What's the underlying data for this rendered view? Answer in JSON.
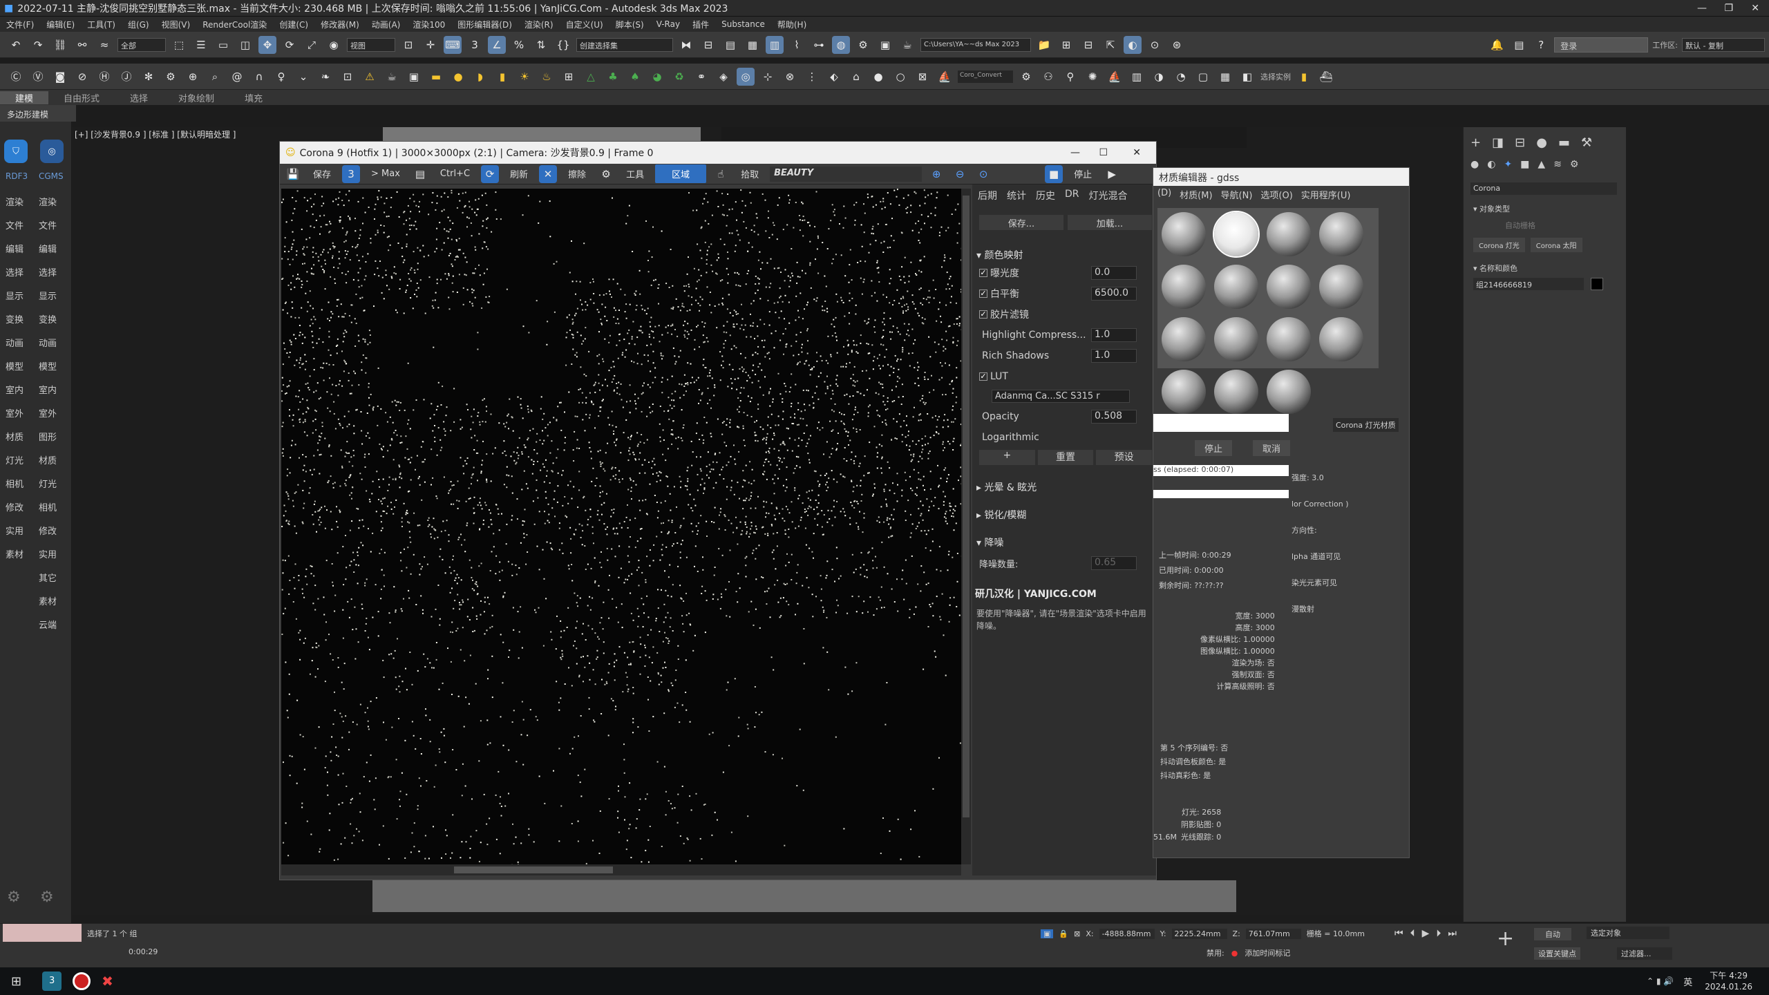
{
  "titlebar": {
    "text": "2022-07-11  主静-沈俊同挑空别墅静态三张.max  - 当前文件大小: 230.468 MB  | 上次保存时间: 嗡嗡久之前 11:55:06  | YanJiCG.Com  - Autodesk 3ds Max 2023"
  },
  "menu": [
    "文件(F)",
    "编辑(E)",
    "工具(T)",
    "组(G)",
    "视图(V)",
    "RenderCool渲染",
    "创建(C)",
    "修改器(M)",
    "动画(A)",
    "渲染100",
    "图形编辑器(D)",
    "渲染(R)",
    "自定义(U)",
    "脚本(S)",
    "V-Ray",
    "插件",
    "Substance",
    "帮助(H)"
  ],
  "toolbar": {
    "selection_filter": "全部",
    "view_dropdown": "视图",
    "named_selection": "创建选择集",
    "path": "C:\\Users\\YA~~ds Max 2023",
    "login": "登录",
    "workspace_label": "工作区:",
    "workspace": "默认 - 复制",
    "corona_convert": "Coro_Convert",
    "ref_label": "选择实例"
  },
  "ribbon": {
    "tabs": [
      "建模",
      "自由形式",
      "选择",
      "对象绘制",
      "填充"
    ],
    "active": "建模",
    "sub": "多边形建模"
  },
  "left_dock": {
    "top_labels": [
      "RDF3",
      "CGMS"
    ],
    "col1": [
      "渲染",
      "文件",
      "编辑",
      "选择",
      "显示",
      "变换",
      "动画",
      "模型",
      "室内",
      "室外",
      "材质",
      "灯光",
      "相机",
      "修改",
      "实用",
      "素材"
    ],
    "col2": [
      "渲染",
      "文件",
      "编辑",
      "选择",
      "显示",
      "变换",
      "动画",
      "模型",
      "室内",
      "室外",
      "图形",
      "材质",
      "灯光",
      "相机",
      "修改",
      "实用",
      "其它",
      "素材",
      "云端"
    ]
  },
  "viewport": {
    "label": "[+] [沙发背景0.9 ] [标准 ] [默认明暗处理 ]"
  },
  "vfb": {
    "title": "Corona 9 (Hotfix 1) | 3000×3000px (2:1) | Camera: 沙发背景0.9 | Frame 0",
    "toolbar": [
      "保存",
      "> Max",
      "Ctrl+C",
      "刷新",
      "擦除",
      "工具",
      "区域",
      "拾取"
    ],
    "channel": "BEAUTY",
    "stop": "停止",
    "panel_tabs": [
      "后期",
      "统计",
      "历史",
      "DR",
      "灯光混合"
    ],
    "save_btn": "保存...",
    "load_btn": "加载...",
    "tone_mapping": "颜色映射",
    "exposure_label": "曝光度",
    "exposure": "0.0",
    "wb_label": "白平衡",
    "wb": "6500.0",
    "film_label": "胶片滤镜",
    "hc_label": "Highlight Compress...",
    "hc": "1.0",
    "rs_label": "Rich Shadows",
    "rs": "1.0",
    "lut_label": "LUT",
    "lut_file": "Adanmq Ca...SC S315 r",
    "opacity_label": "Opacity",
    "opacity": "0.508",
    "log_label": "Logarithmic",
    "plus": "+",
    "reset": "重置",
    "preset": "预设",
    "bloom": "光晕 & 眩光",
    "sharpen": "锐化/模糊",
    "denoise": "降噪",
    "denoise_amt_label": "降噪数量:",
    "denoise_amt": "0.65",
    "credit": "研几汉化 | YANJICG.COM",
    "note": "要使用\"降噪器\", 请在\"场景渲染\"选项卡中启用降噪。"
  },
  "material_editor": {
    "title": "材质编辑器 - gdss",
    "menu": [
      "(D)",
      "材质(M)",
      "导航(N)",
      "选项(O)",
      "实用程序(U)"
    ],
    "stop": "停止",
    "cancel": "取消",
    "elapsed": "ss (elapsed: 0:00:07)",
    "stats": [
      "上一帧时间:  0:00:29",
      "已用时间:  0:00:00",
      "剩余时间:  ??:??:??"
    ],
    "info": [
      "宽度: 3000",
      "高度: 3000",
      "像素纵横比: 1.00000",
      "图像纵横比: 1.00000",
      "渲染为场: 否",
      "强制双面: 否",
      "计算高级照明: 否"
    ],
    "info2": [
      "第 5 个序列编号: 否",
      "抖动调色板颜色: 是",
      "抖动真彩色: 是"
    ],
    "info3": [
      "灯光: 2658",
      "阴影贴图: 0",
      "光线跟踪: 0"
    ],
    "mem": "51.6M",
    "right_labels": [
      "强度: 3.0",
      "lor Correction )",
      "方向性:",
      "lpha 通道可见",
      "染光元素可见",
      "漫散射"
    ],
    "corona_light_mtl": "Corona 灯光材质"
  },
  "command_panel": {
    "renderer": "Corona",
    "object_type": "对象类型",
    "auto_grid": "自动栅格",
    "btn1": "Corona 灯光",
    "btn2": "Corona 太阳",
    "name_color": "名称和颜色",
    "name": "组2146666819"
  },
  "statusbar": {
    "selected": "选择了 1 个 组",
    "time": "0:00:29",
    "x": "-4888.88mm",
    "y": "2225.24mm",
    "z": "761.07mm",
    "grid": "栅格 = 10.0mm",
    "disabled": "禁用:",
    "add_tag": "添加时间标记",
    "auto": "自动",
    "selected_obj": "选定对象",
    "set_key": "设置关键点",
    "filter": "过滤器..."
  },
  "taskbar": {
    "time": "下午 4:29",
    "date": "2024.01.26",
    "lang": "英"
  }
}
